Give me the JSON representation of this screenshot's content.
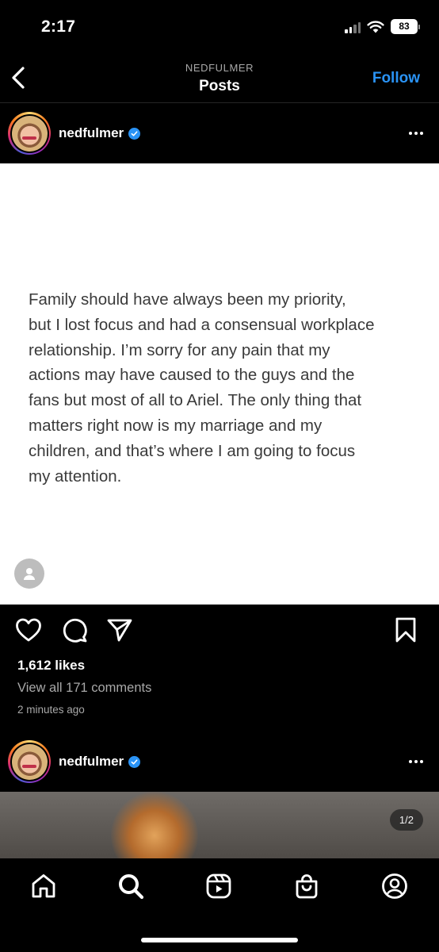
{
  "status_bar": {
    "time": "2:17",
    "battery": "83"
  },
  "header": {
    "subtitle": "NEDFULMER",
    "title": "Posts",
    "follow_label": "Follow"
  },
  "posts": [
    {
      "username": "nedfulmer",
      "verified": true,
      "text": "Family should have always been my priority,\nbut I lost focus and had a consensual workplace\nrelationship.  I’m sorry for any pain that my\nactions may have caused to the guys and the\nfans but most of all to Ariel. The only thing that\nmatters right now is my marriage and my\nchildren, and that’s where I am going to focus\nmy attention.",
      "likes": "1,612 likes",
      "comments_link": "View all 171 comments",
      "time_ago": "2 minutes ago"
    },
    {
      "username": "nedfulmer",
      "verified": true,
      "media_counter": "1/2"
    }
  ],
  "icons": {
    "actions": [
      "heart-icon",
      "comment-icon",
      "share-icon",
      "bookmark-icon"
    ],
    "tabbar": [
      "home-icon",
      "search-icon",
      "reels-icon",
      "shop-icon",
      "profile-icon"
    ]
  },
  "colors": {
    "accent": "#2a93f5",
    "background": "#000000",
    "card": "#ffffff",
    "muted": "#a8a8a8"
  }
}
